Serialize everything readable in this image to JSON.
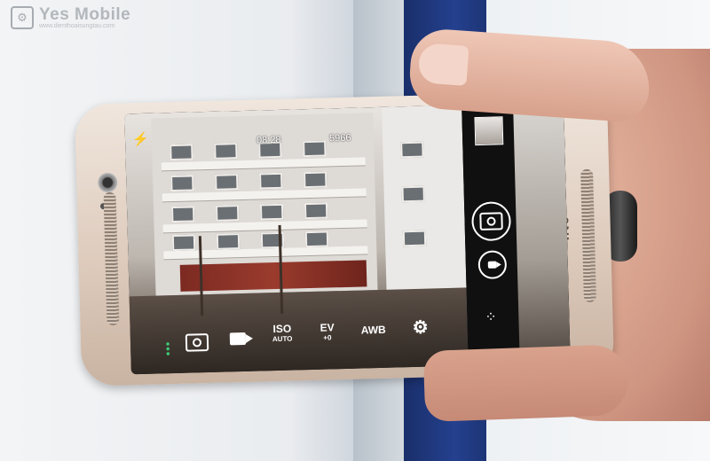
{
  "watermark": {
    "brand": "Yes Mobile",
    "site": "www.dienthoaisungtau.com"
  },
  "phone": {
    "brand_logo": "htc"
  },
  "camera_ui": {
    "top_status_time": "08:28",
    "top_status_count": "5966",
    "controls": [
      {
        "name": "photo-mode",
        "icon": "camera-icon"
      },
      {
        "name": "video-mode",
        "icon": "video-icon"
      },
      {
        "name": "iso",
        "label": "ISO",
        "value": "AUTO"
      },
      {
        "name": "ev",
        "label": "EV",
        "value": "+0"
      },
      {
        "name": "awb",
        "label": "AWB"
      },
      {
        "name": "settings",
        "icon": "gear-icon"
      }
    ],
    "side_panel": {
      "thumbnail": "last-photo-thumbnail",
      "shutter_icon": "camera-icon",
      "record_icon": "video-icon",
      "mode_icon": "grid-icon"
    }
  },
  "colors": {
    "accent_dots": "#3ed07a",
    "phone_body": "#dcc9ba"
  }
}
